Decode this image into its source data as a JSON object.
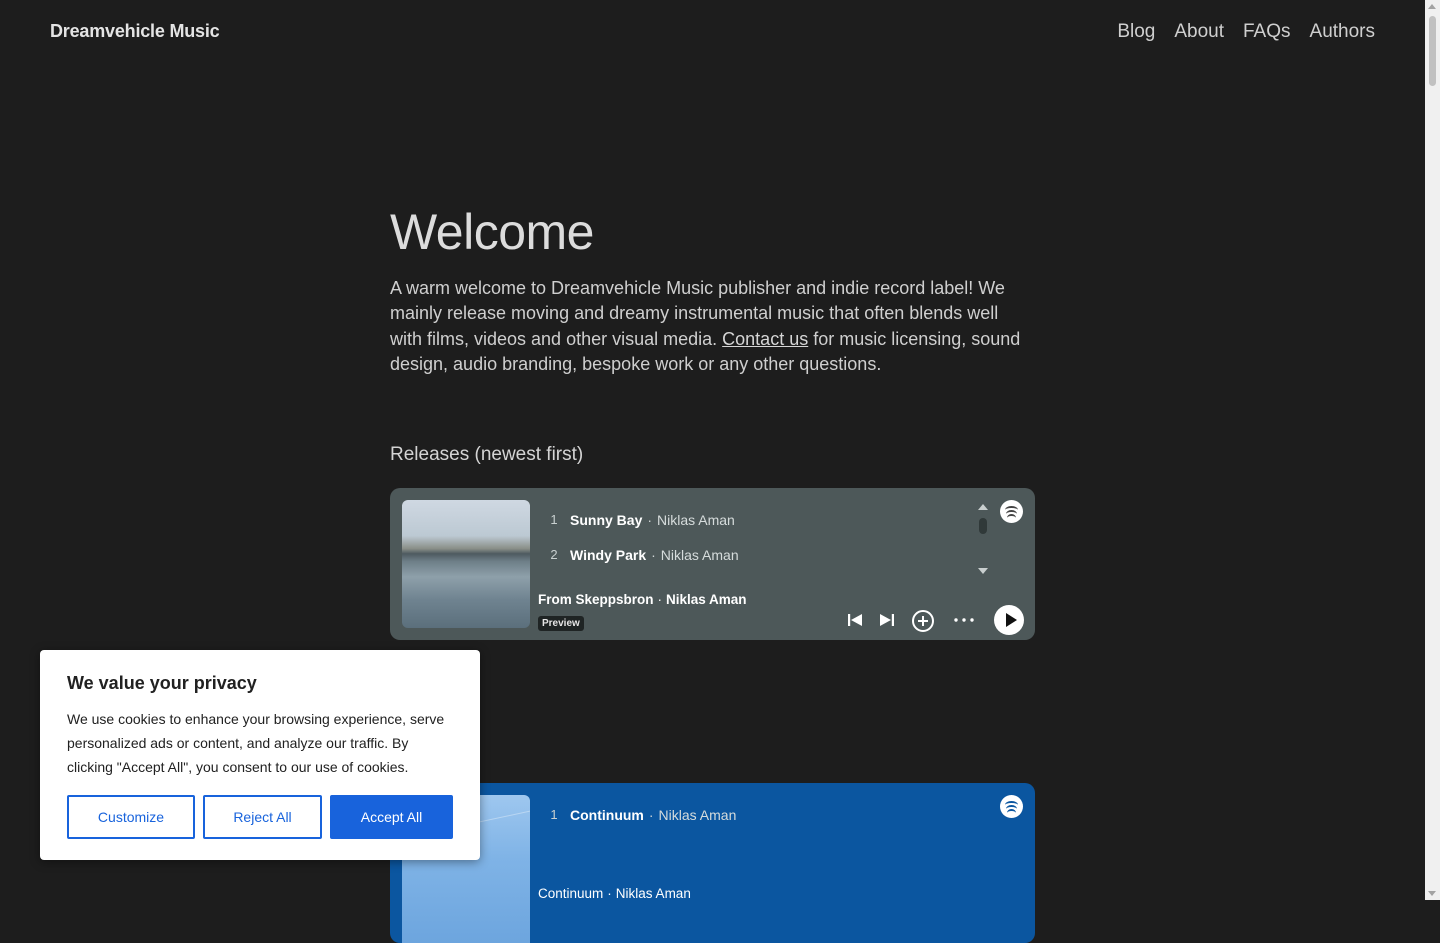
{
  "header": {
    "brand": "Dreamvehicle Music",
    "nav": [
      "Blog",
      "About",
      "FAQs",
      "Authors"
    ]
  },
  "main": {
    "title": "Welcome",
    "intro_before": "A warm welcome to Dreamvehicle Music publisher and indie record label! We mainly release moving and dreamy instrumental music that often blends well with films, videos and other visual media. ",
    "intro_link": "Contact us",
    "intro_after": " for music licensing, sound design, audio branding, bespoke work or any other questions.",
    "releases_heading": "Releases (newest first)"
  },
  "players": [
    {
      "tracks": [
        {
          "num": "1",
          "title": "Sunny Bay",
          "sep": "·",
          "artist": "Niklas Aman"
        },
        {
          "num": "2",
          "title": "Windy Park",
          "sep": "·",
          "artist": "Niklas Aman"
        }
      ],
      "album": "From Skeppsbron",
      "sep": "·",
      "artist": "Niklas Aman",
      "badge": "Preview",
      "background": "#4d5859"
    },
    {
      "tracks": [
        {
          "num": "1",
          "title": "Continuum",
          "sep": "·",
          "artist": "Niklas Aman"
        }
      ],
      "album": "Continuum",
      "sep": "·",
      "artist": "Niklas Aman",
      "background": "#0b56a0"
    }
  ],
  "cookie": {
    "title": "We value your privacy",
    "text": "We use cookies to enhance your browsing experience, serve personalized ads or content, and analyze our traffic. By clicking \"Accept All\", you consent to our use of cookies.",
    "customize": "Customize",
    "reject": "Reject All",
    "accept": "Accept All",
    "accent": "#1863dc"
  },
  "icons": {
    "prev": "skip-previous-icon",
    "next": "skip-next-icon",
    "add": "add-circle-icon",
    "more": "more-horizontal-icon",
    "play": "play-icon",
    "spotify": "spotify-logo-icon"
  }
}
